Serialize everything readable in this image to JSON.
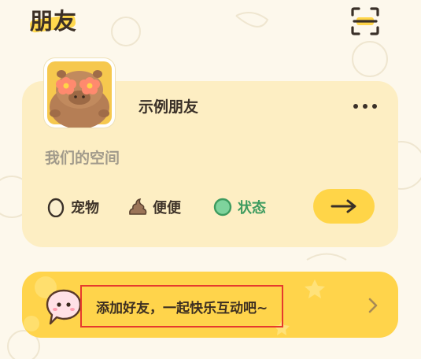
{
  "header": {
    "title": "朋友",
    "scan_icon": "scan-icon"
  },
  "friend_card": {
    "name": "示例朋友",
    "avatar_icon": "capybara-avatar",
    "more_icon": "more-dots-icon",
    "subtitle": "我们的空间",
    "stats": [
      {
        "icon": "egg-icon",
        "label": "宠物"
      },
      {
        "icon": "poop-icon",
        "label": "便便"
      },
      {
        "icon": "status-dot-icon",
        "label": "状态"
      }
    ],
    "action_icon": "arrow-right-icon"
  },
  "banner": {
    "text": "添加好友，一起快乐互动吧~",
    "icon": "chat-bubble-icon",
    "chevron": "chevron-right-icon"
  },
  "colors": {
    "background": "#fdf8ec",
    "card": "#fdeec3",
    "accent": "#ffd548",
    "status_green": "#3d9b5f",
    "highlight_border": "#e63a2e"
  }
}
